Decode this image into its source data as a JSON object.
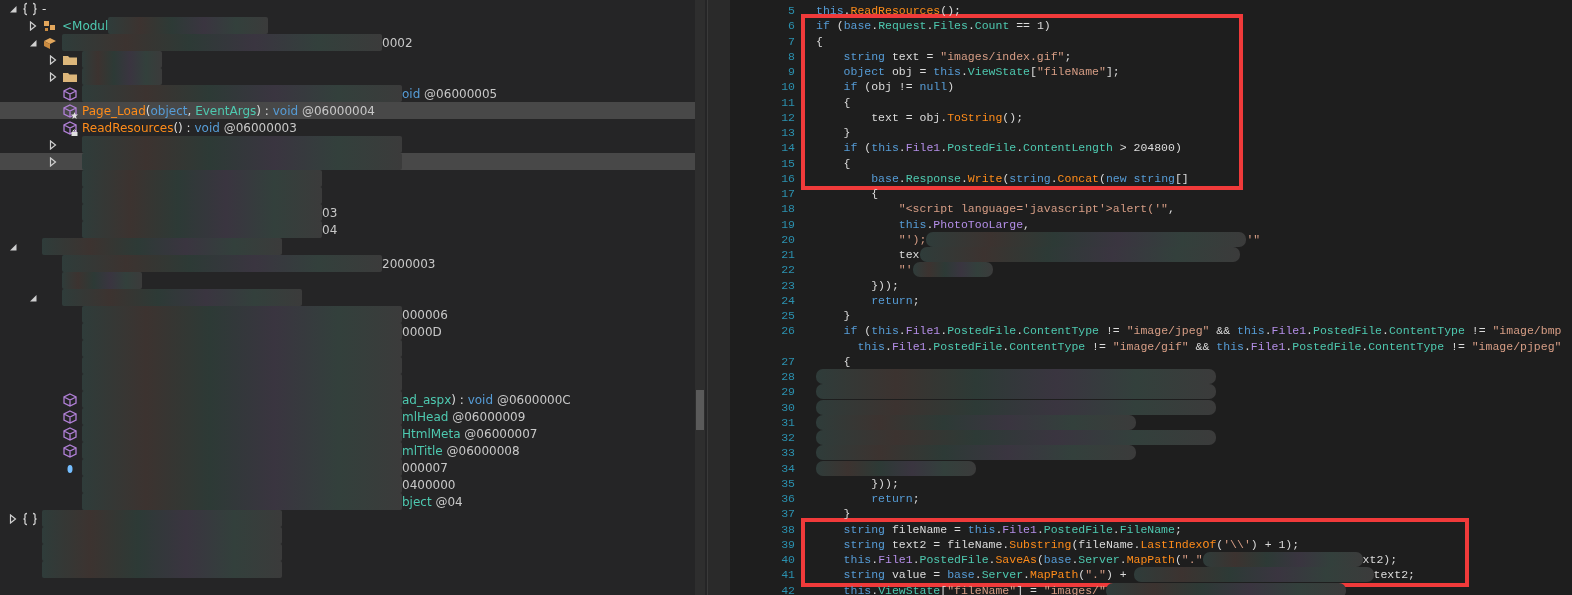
{
  "tree": [
    {
      "kind": "namespace",
      "expanded": true,
      "selected": false,
      "tokens": [
        {
          "kind": "plain",
          "text": "-"
        }
      ],
      "children": [
        {
          "kind": "module",
          "expanded": false,
          "selected": false,
          "tokens": [
            {
              "kind": "type",
              "text": "<Modul"
            },
            {
              "kind": "redacted"
            },
            {
              "kind": "redacted"
            }
          ]
        },
        {
          "kind": "class",
          "expanded": true,
          "selected": false,
          "tokens": [
            {
              "kind": "redacted"
            },
            {
              "kind": "redacted"
            },
            {
              "kind": "redacted"
            },
            {
              "kind": "redacted"
            },
            {
              "kind": "number",
              "text": "0002"
            }
          ],
          "children": [
            {
              "kind": "folder",
              "expanded": false,
              "selected": false,
              "tokens": [
                {
                  "kind": "redacted"
                }
              ]
            },
            {
              "kind": "folder",
              "expanded": false,
              "selected": false,
              "tokens": [
                {
                  "kind": "redacted"
                }
              ]
            },
            {
              "kind": "method",
              "selected": false,
              "tokens": [
                {
                  "kind": "redacted"
                },
                {
                  "kind": "redacted"
                },
                {
                  "kind": "redacted"
                },
                {
                  "kind": "redacted"
                },
                {
                  "kind": "keyword",
                  "text": "oid"
                },
                {
                  "kind": "number",
                  "text": " @06000005"
                }
              ]
            },
            {
              "kind": "starmethod",
              "selected": true,
              "tokens": [
                {
                  "kind": "method",
                  "text": "Page_Load"
                },
                {
                  "kind": "plain",
                  "text": "("
                },
                {
                  "kind": "keyword",
                  "text": "object"
                },
                {
                  "kind": "plain",
                  "text": ", "
                },
                {
                  "kind": "type",
                  "text": "EventArgs"
                },
                {
                  "kind": "plain",
                  "text": ") : "
                },
                {
                  "kind": "keyword",
                  "text": "void"
                },
                {
                  "kind": "number",
                  "text": " @06000004"
                }
              ]
            },
            {
              "kind": "lockmethod",
              "selected": false,
              "tokens": [
                {
                  "kind": "method",
                  "text": "ReadResources"
                },
                {
                  "kind": "plain",
                  "text": "() : "
                },
                {
                  "kind": "keyword",
                  "text": "void"
                },
                {
                  "kind": "number",
                  "text": " @06000003"
                }
              ]
            },
            {
              "expanded": false,
              "selected": false,
              "tokens": [
                {
                  "kind": "redacted"
                },
                {
                  "kind": "redacted"
                },
                {
                  "kind": "redacted"
                },
                {
                  "kind": "redacted"
                }
              ]
            },
            {
              "expanded": false,
              "selected": true,
              "tokens": [
                {
                  "kind": "redacted"
                },
                {
                  "kind": "redacted"
                },
                {
                  "kind": "redacted"
                },
                {
                  "kind": "redacted"
                }
              ]
            },
            {
              "selected": false,
              "tokens": [
                {
                  "kind": "redacted"
                },
                {
                  "kind": "redacted"
                },
                {
                  "kind": "redacted"
                }
              ]
            },
            {
              "selected": false,
              "tokens": [
                {
                  "kind": "redacted"
                },
                {
                  "kind": "redacted"
                },
                {
                  "kind": "redacted"
                }
              ]
            },
            {
              "selected": false,
              "tokens": [
                {
                  "kind": "redacted"
                },
                {
                  "kind": "redacted"
                },
                {
                  "kind": "redacted"
                },
                {
                  "kind": "number",
                  "text": "03"
                }
              ]
            },
            {
              "selected": false,
              "tokens": [
                {
                  "kind": "redacted"
                },
                {
                  "kind": "redacted"
                },
                {
                  "kind": "redacted"
                },
                {
                  "kind": "number",
                  "text": "04"
                }
              ]
            }
          ]
        }
      ]
    },
    {
      "expanded": true,
      "selected": false,
      "tokens": [
        {
          "kind": "redacted"
        },
        {
          "kind": "redacted"
        },
        {
          "kind": "redacted"
        }
      ],
      "children": [
        {
          "selected": false,
          "tokens": [
            {
              "kind": "redacted"
            },
            {
              "kind": "redacted"
            },
            {
              "kind": "redacted"
            },
            {
              "kind": "redacted"
            },
            {
              "kind": "number",
              "text": "2000003"
            }
          ]
        },
        {
          "selected": false,
          "tokens": [
            {
              "kind": "redacted"
            }
          ]
        },
        {
          "expanded": true,
          "selected": false,
          "tokens": [
            {
              "kind": "redacted"
            },
            {
              "kind": "redacted"
            },
            {
              "kind": "redacted"
            }
          ],
          "children": [
            {
              "selected": false,
              "tokens": [
                {
                  "kind": "redacted"
                },
                {
                  "kind": "redacted"
                },
                {
                  "kind": "redacted"
                },
                {
                  "kind": "redacted"
                },
                {
                  "kind": "number",
                  "text": "000006"
                }
              ]
            },
            {
              "selected": false,
              "tokens": [
                {
                  "kind": "redacted"
                },
                {
                  "kind": "redacted"
                },
                {
                  "kind": "redacted"
                },
                {
                  "kind": "redacted"
                },
                {
                  "kind": "number",
                  "text": "0000D"
                }
              ]
            },
            {
              "selected": false,
              "tokens": [
                {
                  "kind": "redacted"
                },
                {
                  "kind": "redacted"
                },
                {
                  "kind": "redacted"
                },
                {
                  "kind": "redacted"
                }
              ]
            },
            {
              "selected": false,
              "tokens": [
                {
                  "kind": "redacted"
                },
                {
                  "kind": "redacted"
                },
                {
                  "kind": "redacted"
                },
                {
                  "kind": "redacted"
                }
              ]
            },
            {
              "selected": false,
              "tokens": [
                {
                  "kind": "redacted"
                },
                {
                  "kind": "redacted"
                },
                {
                  "kind": "redacted"
                },
                {
                  "kind": "redacted"
                }
              ]
            },
            {
              "kind": "method",
              "selected": false,
              "tokens": [
                {
                  "kind": "redacted"
                },
                {
                  "kind": "redacted"
                },
                {
                  "kind": "redacted"
                },
                {
                  "kind": "redacted"
                },
                {
                  "kind": "type",
                  "text": "ad_aspx"
                },
                {
                  "kind": "plain",
                  "text": ") : "
                },
                {
                  "kind": "keyword",
                  "text": "void"
                },
                {
                  "kind": "number",
                  "text": " @0600000C"
                }
              ]
            },
            {
              "kind": "method",
              "selected": false,
              "tokens": [
                {
                  "kind": "redacted"
                },
                {
                  "kind": "redacted"
                },
                {
                  "kind": "redacted"
                },
                {
                  "kind": "redacted"
                },
                {
                  "kind": "type",
                  "text": "mlHead"
                },
                {
                  "kind": "number",
                  "text": " @06000009"
                }
              ]
            },
            {
              "kind": "method",
              "selected": false,
              "tokens": [
                {
                  "kind": "redacted"
                },
                {
                  "kind": "redacted"
                },
                {
                  "kind": "redacted"
                },
                {
                  "kind": "redacted"
                },
                {
                  "kind": "type",
                  "text": "HtmlMeta"
                },
                {
                  "kind": "number",
                  "text": " @06000007"
                }
              ]
            },
            {
              "kind": "method",
              "selected": false,
              "tokens": [
                {
                  "kind": "redacted"
                },
                {
                  "kind": "redacted"
                },
                {
                  "kind": "redacted"
                },
                {
                  "kind": "redacted"
                },
                {
                  "kind": "type",
                  "text": "mlTitle"
                },
                {
                  "kind": "number",
                  "text": " @06000008"
                }
              ]
            },
            {
              "kind": "property",
              "selected": false,
              "tokens": [
                {
                  "kind": "redacted"
                },
                {
                  "kind": "redacted"
                },
                {
                  "kind": "redacted"
                },
                {
                  "kind": "redacted"
                },
                {
                  "kind": "number",
                  "text": "000007"
                }
              ]
            },
            {
              "selected": false,
              "tokens": [
                {
                  "kind": "redacted"
                },
                {
                  "kind": "redacted"
                },
                {
                  "kind": "redacted"
                },
                {
                  "kind": "redacted"
                },
                {
                  "kind": "number",
                  "text": "0400000"
                }
              ]
            },
            {
              "selected": false,
              "tokens": [
                {
                  "kind": "redacted"
                },
                {
                  "kind": "redacted"
                },
                {
                  "kind": "redacted"
                },
                {
                  "kind": "redacted"
                },
                {
                  "kind": "type",
                  "text": "bject"
                },
                {
                  "kind": "number",
                  "text": " @04"
                }
              ]
            }
          ]
        }
      ]
    },
    {
      "kind": "namespace",
      "expanded": false,
      "selected": false,
      "tokens": [
        {
          "kind": "redacted"
        },
        {
          "kind": "redacted"
        },
        {
          "kind": "redacted"
        }
      ]
    },
    {
      "selected": false,
      "tokens": [
        {
          "kind": "redacted"
        },
        {
          "kind": "redacted"
        },
        {
          "kind": "redacted"
        }
      ]
    },
    {
      "selected": false,
      "tokens": [
        {
          "kind": "redacted"
        },
        {
          "kind": "redacted"
        },
        {
          "kind": "redacted"
        }
      ]
    },
    {
      "selected": false,
      "tokens": [
        {
          "kind": "redacted"
        },
        {
          "kind": "redacted"
        },
        {
          "kind": "redacted"
        }
      ]
    }
  ],
  "code": [
    {
      "boxed": false,
      "lines": [
        {
          "number": "5",
          "tokens": [
            {
              "kind": "keyword",
              "text": "this"
            },
            {
              "kind": "plain",
              "text": "."
            },
            {
              "kind": "method",
              "text": "ReadResources"
            },
            {
              "kind": "plain",
              "text": "();"
            }
          ]
        }
      ]
    },
    {
      "boxed": true,
      "lines": [
        {
          "number": "6",
          "tokens": [
            {
              "kind": "keyword",
              "text": "if"
            },
            {
              "kind": "plain",
              "text": " ("
            },
            {
              "kind": "keyword",
              "text": "base"
            },
            {
              "kind": "plain",
              "text": "."
            },
            {
              "kind": "type",
              "text": "Request"
            },
            {
              "kind": "plain",
              "text": "."
            },
            {
              "kind": "type",
              "text": "Files"
            },
            {
              "kind": "plain",
              "text": "."
            },
            {
              "kind": "type",
              "text": "Count"
            },
            {
              "kind": "plain",
              "text": " == 1)"
            }
          ]
        },
        {
          "number": "7",
          "tokens": [
            {
              "kind": "plain",
              "text": "{"
            }
          ]
        },
        {
          "number": "8",
          "tokens": [
            {
              "kind": "keyword",
              "text": "    string"
            },
            {
              "kind": "plain",
              "text": " text = "
            },
            {
              "kind": "string",
              "text": "\"images/index.gif\""
            },
            {
              "kind": "plain",
              "text": ";"
            }
          ]
        },
        {
          "number": "9",
          "tokens": [
            {
              "kind": "keyword",
              "text": "    object"
            },
            {
              "kind": "plain",
              "text": " obj = "
            },
            {
              "kind": "keyword",
              "text": "this"
            },
            {
              "kind": "plain",
              "text": "."
            },
            {
              "kind": "type",
              "text": "ViewState"
            },
            {
              "kind": "plain",
              "text": "["
            },
            {
              "kind": "string",
              "text": "\"fileName\""
            },
            {
              "kind": "plain",
              "text": "];"
            }
          ]
        },
        {
          "number": "10",
          "tokens": [
            {
              "kind": "keyword",
              "text": "    if"
            },
            {
              "kind": "plain",
              "text": " (obj != "
            },
            {
              "kind": "keyword",
              "text": "null"
            },
            {
              "kind": "plain",
              "text": ")"
            }
          ]
        },
        {
          "number": "11",
          "tokens": [
            {
              "kind": "plain",
              "text": "    {"
            }
          ]
        },
        {
          "number": "12",
          "tokens": [
            {
              "kind": "plain",
              "text": "        text = obj."
            },
            {
              "kind": "method",
              "text": "ToString"
            },
            {
              "kind": "plain",
              "text": "();"
            }
          ]
        },
        {
          "number": "13",
          "tokens": [
            {
              "kind": "plain",
              "text": "    }"
            }
          ]
        },
        {
          "number": "14",
          "tokens": [
            {
              "kind": "keyword",
              "text": "    if"
            },
            {
              "kind": "plain",
              "text": " ("
            },
            {
              "kind": "keyword",
              "text": "this"
            },
            {
              "kind": "plain",
              "text": "."
            },
            {
              "kind": "field",
              "text": "File1"
            },
            {
              "kind": "plain",
              "text": "."
            },
            {
              "kind": "type",
              "text": "PostedFile"
            },
            {
              "kind": "plain",
              "text": "."
            },
            {
              "kind": "type",
              "text": "ContentLength"
            },
            {
              "kind": "plain",
              "text": " > 204800)"
            }
          ]
        },
        {
          "number": "15",
          "tokens": [
            {
              "kind": "plain",
              "text": "    {"
            }
          ]
        },
        {
          "number": "16",
          "tokens": [
            {
              "kind": "keyword",
              "text": "        base"
            },
            {
              "kind": "plain",
              "text": "."
            },
            {
              "kind": "type",
              "text": "Response"
            },
            {
              "kind": "plain",
              "text": "."
            },
            {
              "kind": "method",
              "text": "Write"
            },
            {
              "kind": "plain",
              "text": "("
            },
            {
              "kind": "keyword",
              "text": "string"
            },
            {
              "kind": "plain",
              "text": "."
            },
            {
              "kind": "method",
              "text": "Concat"
            },
            {
              "kind": "plain",
              "text": "("
            },
            {
              "kind": "keyword",
              "text": "new string"
            },
            {
              "kind": "plain",
              "text": "[]"
            }
          ]
        }
      ]
    },
    {
      "boxed": false,
      "lines": [
        {
          "number": "17",
          "tokens": [
            {
              "kind": "plain",
              "text": "        {"
            }
          ]
        },
        {
          "number": "18",
          "tokens": [
            {
              "kind": "string",
              "text": "            \"<script language='javascript'>alert('\""
            },
            {
              "kind": "plain",
              "text": ","
            }
          ]
        },
        {
          "number": "19",
          "tokens": [
            {
              "kind": "keyword",
              "text": "            this"
            },
            {
              "kind": "plain",
              "text": "."
            },
            {
              "kind": "field",
              "text": "PhotoTooLarge"
            },
            {
              "kind": "plain",
              "text": ","
            }
          ]
        },
        {
          "number": "20",
          "tokens": [
            {
              "kind": "string",
              "text": "            \"');"
            },
            {
              "kind": "redacted"
            },
            {
              "kind": "redacted"
            },
            {
              "kind": "redacted"
            },
            {
              "kind": "redacted"
            },
            {
              "kind": "string",
              "text": "'\""
            }
          ]
        },
        {
          "number": "21",
          "tokens": [
            {
              "kind": "plain",
              "text": "            tex"
            },
            {
              "kind": "redacted"
            },
            {
              "kind": "redacted"
            },
            {
              "kind": "redacted"
            },
            {
              "kind": "redacted"
            }
          ]
        },
        {
          "number": "22",
          "tokens": [
            {
              "kind": "string",
              "text": "            \"'"
            },
            {
              "kind": "redacted"
            }
          ]
        },
        {
          "number": "23",
          "tokens": [
            {
              "kind": "plain",
              "text": "        }));"
            }
          ]
        },
        {
          "number": "24",
          "tokens": [
            {
              "kind": "keyword",
              "text": "        return"
            },
            {
              "kind": "plain",
              "text": ";"
            }
          ]
        },
        {
          "number": "25",
          "tokens": [
            {
              "kind": "plain",
              "text": "    }"
            }
          ]
        },
        {
          "number": "26",
          "tokens": [
            {
              "kind": "keyword",
              "text": "    if"
            },
            {
              "kind": "plain",
              "text": " ("
            },
            {
              "kind": "keyword",
              "text": "this"
            },
            {
              "kind": "plain",
              "text": "."
            },
            {
              "kind": "field",
              "text": "File1"
            },
            {
              "kind": "plain",
              "text": "."
            },
            {
              "kind": "type",
              "text": "PostedFile"
            },
            {
              "kind": "plain",
              "text": "."
            },
            {
              "kind": "type",
              "text": "ContentType"
            },
            {
              "kind": "plain",
              "text": " != "
            },
            {
              "kind": "string",
              "text": "\"image/jpeg\""
            },
            {
              "kind": "plain",
              "text": " && "
            },
            {
              "kind": "keyword",
              "text": "this"
            },
            {
              "kind": "plain",
              "text": "."
            },
            {
              "kind": "field",
              "text": "File1"
            },
            {
              "kind": "plain",
              "text": "."
            },
            {
              "kind": "type",
              "text": "PostedFile"
            },
            {
              "kind": "plain",
              "text": "."
            },
            {
              "kind": "type",
              "text": "ContentType"
            },
            {
              "kind": "plain",
              "text": " != "
            },
            {
              "kind": "string",
              "text": "\"image/bmp"
            }
          ]
        },
        {
          "tokens": [
            {
              "kind": "keyword",
              "text": "      this"
            },
            {
              "kind": "plain",
              "text": "."
            },
            {
              "kind": "field",
              "text": "File1"
            },
            {
              "kind": "plain",
              "text": "."
            },
            {
              "kind": "type",
              "text": "PostedFile"
            },
            {
              "kind": "plain",
              "text": "."
            },
            {
              "kind": "type",
              "text": "ContentType"
            },
            {
              "kind": "plain",
              "text": " != "
            },
            {
              "kind": "string",
              "text": "\"image/gif\""
            },
            {
              "kind": "plain",
              "text": " && "
            },
            {
              "kind": "keyword",
              "text": "this"
            },
            {
              "kind": "plain",
              "text": "."
            },
            {
              "kind": "field",
              "text": "File1"
            },
            {
              "kind": "plain",
              "text": "."
            },
            {
              "kind": "type",
              "text": "PostedFile"
            },
            {
              "kind": "plain",
              "text": "."
            },
            {
              "kind": "type",
              "text": "ContentType"
            },
            {
              "kind": "plain",
              "text": " != "
            },
            {
              "kind": "string",
              "text": "\"image/pjpeg\""
            }
          ]
        },
        {
          "number": "27",
          "tokens": [
            {
              "kind": "plain",
              "text": "    {"
            }
          ]
        },
        {
          "number": "28",
          "tokens": [
            {
              "kind": "redacted"
            },
            {
              "kind": "redacted"
            },
            {
              "kind": "redacted"
            },
            {
              "kind": "redacted"
            },
            {
              "kind": "redacted"
            }
          ]
        },
        {
          "number": "29",
          "tokens": [
            {
              "kind": "redacted"
            },
            {
              "kind": "redacted"
            },
            {
              "kind": "redacted"
            },
            {
              "kind": "redacted"
            },
            {
              "kind": "redacted"
            }
          ]
        },
        {
          "number": "30",
          "tokens": [
            {
              "kind": "redacted"
            },
            {
              "kind": "redacted"
            },
            {
              "kind": "redacted"
            },
            {
              "kind": "redacted"
            },
            {
              "kind": "redacted"
            }
          ]
        },
        {
          "number": "31",
          "tokens": [
            {
              "kind": "redacted"
            },
            {
              "kind": "redacted"
            },
            {
              "kind": "redacted"
            },
            {
              "kind": "redacted"
            }
          ]
        },
        {
          "number": "32",
          "tokens": [
            {
              "kind": "redacted"
            },
            {
              "kind": "redacted"
            },
            {
              "kind": "redacted"
            },
            {
              "kind": "redacted"
            },
            {
              "kind": "redacted"
            }
          ]
        },
        {
          "number": "33",
          "tokens": [
            {
              "kind": "redacted"
            },
            {
              "kind": "redacted"
            },
            {
              "kind": "redacted"
            },
            {
              "kind": "redacted"
            }
          ]
        },
        {
          "number": "34",
          "tokens": [
            {
              "kind": "redacted"
            },
            {
              "kind": "redacted"
            }
          ]
        },
        {
          "number": "35",
          "tokens": [
            {
              "kind": "plain",
              "text": "        }));"
            }
          ]
        },
        {
          "number": "36",
          "tokens": [
            {
              "kind": "keyword",
              "text": "        return"
            },
            {
              "kind": "plain",
              "text": ";"
            }
          ]
        },
        {
          "number": "37",
          "tokens": [
            {
              "kind": "plain",
              "text": "    }"
            }
          ]
        }
      ]
    },
    {
      "boxed": true,
      "lines": [
        {
          "number": "38",
          "tokens": [
            {
              "kind": "keyword",
              "text": "    string"
            },
            {
              "kind": "plain",
              "text": " fileName = "
            },
            {
              "kind": "keyword",
              "text": "this"
            },
            {
              "kind": "plain",
              "text": "."
            },
            {
              "kind": "field",
              "text": "File1"
            },
            {
              "kind": "plain",
              "text": "."
            },
            {
              "kind": "type",
              "text": "PostedFile"
            },
            {
              "kind": "plain",
              "text": "."
            },
            {
              "kind": "type",
              "text": "FileName"
            },
            {
              "kind": "plain",
              "text": ";"
            }
          ]
        },
        {
          "number": "39",
          "tokens": [
            {
              "kind": "keyword",
              "text": "    string"
            },
            {
              "kind": "plain",
              "text": " text2 = fileName."
            },
            {
              "kind": "method",
              "text": "Substring"
            },
            {
              "kind": "plain",
              "text": "(fileName."
            },
            {
              "kind": "method",
              "text": "LastIndexOf"
            },
            {
              "kind": "plain",
              "text": "("
            },
            {
              "kind": "string",
              "text": "'\\\\'"
            },
            {
              "kind": "plain",
              "text": ") + 1);"
            }
          ]
        },
        {
          "number": "40",
          "tokens": [
            {
              "kind": "keyword",
              "text": "    this"
            },
            {
              "kind": "plain",
              "text": "."
            },
            {
              "kind": "field",
              "text": "File1"
            },
            {
              "kind": "plain",
              "text": "."
            },
            {
              "kind": "type",
              "text": "PostedFile"
            },
            {
              "kind": "plain",
              "text": "."
            },
            {
              "kind": "method",
              "text": "SaveAs"
            },
            {
              "kind": "plain",
              "text": "("
            },
            {
              "kind": "keyword",
              "text": "base"
            },
            {
              "kind": "plain",
              "text": "."
            },
            {
              "kind": "type",
              "text": "Server"
            },
            {
              "kind": "plain",
              "text": "."
            },
            {
              "kind": "method",
              "text": "MapPath"
            },
            {
              "kind": "plain",
              "text": "("
            },
            {
              "kind": "string",
              "text": "\".\""
            },
            {
              "kind": "redacted"
            },
            {
              "kind": "redacted"
            },
            {
              "kind": "plain",
              "text": "xt2);"
            }
          ]
        },
        {
          "number": "41",
          "tokens": [
            {
              "kind": "keyword",
              "text": "    string"
            },
            {
              "kind": "plain",
              "text": " value = "
            },
            {
              "kind": "keyword",
              "text": "base"
            },
            {
              "kind": "plain",
              "text": "."
            },
            {
              "kind": "type",
              "text": "Server"
            },
            {
              "kind": "plain",
              "text": "."
            },
            {
              "kind": "method",
              "text": "MapPath"
            },
            {
              "kind": "plain",
              "text": "("
            },
            {
              "kind": "string",
              "text": "\".\""
            },
            {
              "kind": "plain",
              "text": ") + "
            },
            {
              "kind": "redacted"
            },
            {
              "kind": "redacted"
            },
            {
              "kind": "redacted"
            },
            {
              "kind": "plain",
              "text": "text2;"
            }
          ]
        }
      ]
    },
    {
      "boxed": false,
      "lines": [
        {
          "number": "42",
          "tokens": [
            {
              "kind": "keyword",
              "text": "    this"
            },
            {
              "kind": "plain",
              "text": "."
            },
            {
              "kind": "type",
              "text": "ViewState"
            },
            {
              "kind": "plain",
              "text": "["
            },
            {
              "kind": "string",
              "text": "\"fileName\""
            },
            {
              "kind": "plain",
              "text": "] = "
            },
            {
              "kind": "string",
              "text": "\"images/\""
            },
            {
              "kind": "redacted"
            },
            {
              "kind": "redacted"
            },
            {
              "kind": "redacted"
            }
          ]
        }
      ]
    }
  ]
}
